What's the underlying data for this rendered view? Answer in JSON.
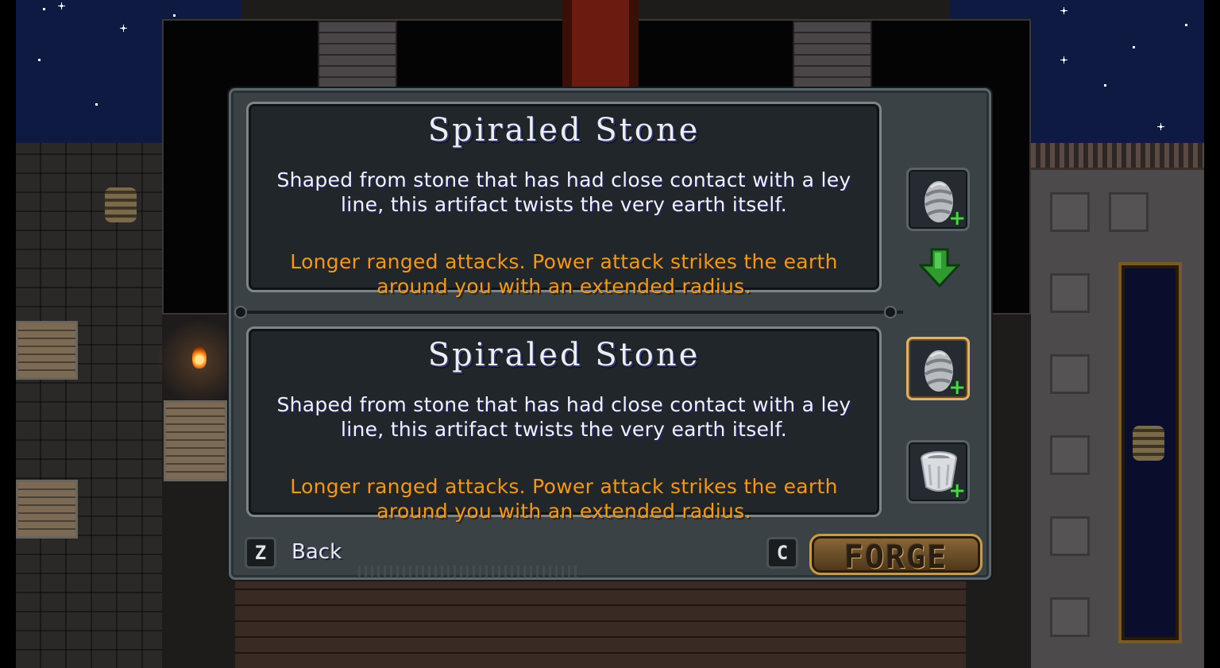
{
  "upgrade_dialog": {
    "current_item": {
      "title": "Spiraled Stone",
      "description": "Shaped from stone that has had close contact with a ley line, this artifact twists the very earth itself.",
      "effect": "Longer ranged attacks. Power attack strikes the earth around you with an extended radius."
    },
    "new_item": {
      "title": "Spiraled Stone",
      "description": "Shaped from stone that has had close contact with a ley line, this artifact twists the very earth itself.",
      "effect": "Longer ranged attacks. Power attack strikes the earth around you with an extended radius."
    },
    "slots": [
      {
        "icon": "spiraled-stone-icon",
        "plus": "+",
        "selected": false
      },
      {
        "icon": "spiraled-stone-icon",
        "plus": "+",
        "selected": true
      },
      {
        "icon": "chalice-icon",
        "plus": "+",
        "selected": false
      }
    ],
    "back": {
      "key": "Z",
      "label": "Back"
    },
    "forge": {
      "key": "C",
      "label": "FORGE"
    }
  },
  "colors": {
    "panel": "#3a4246",
    "card": "#21262a",
    "description_text": "#f2f2f6",
    "effect_text": "#e69a2e",
    "plus": "#4bd24b",
    "selected_border": "#e0b26a"
  }
}
